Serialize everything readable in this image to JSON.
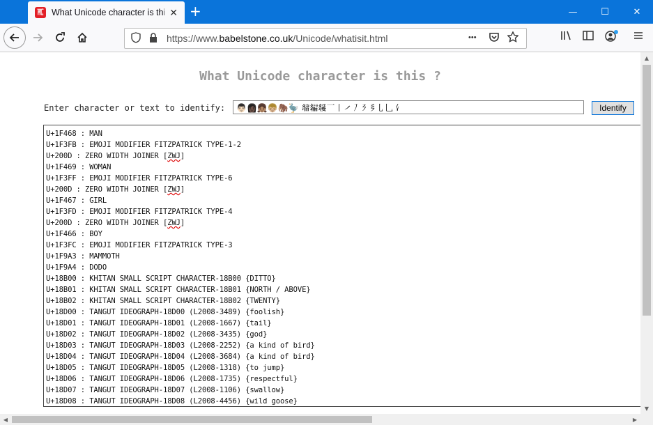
{
  "browser": {
    "tab_title": "What Unicode character is this",
    "tab_favicon_glyph": "𗀀",
    "new_tab_glyph": "+",
    "close_glyph": "✕",
    "min_glyph": "—",
    "max_glyph": "☐",
    "win_close_glyph": "✕",
    "url_scheme": "https://www.",
    "url_domain": "babelstone.co.uk",
    "url_path": "/Unicode/whatisit.html",
    "page_actions_glyph": "•••"
  },
  "page": {
    "title": "What Unicode character is this ?",
    "prompt": "Enter character or text to identify:",
    "input_value": "👨🏻‍👩🏿‍👧🏽‍👦🏼🦣🦤 𘀀𘀁𘀂𘠀𘠁𘠂𘠃𘠄𘠅𘠆𘠇𘠈",
    "identify_label": "Identify"
  },
  "output_lines": [
    "U+1F468 : MAN",
    "U+1F3FB : EMOJI MODIFIER FITZPATRICK TYPE-1-2",
    "U+200D : ZERO WIDTH JOINER [ZWJ]",
    "U+1F469 : WOMAN",
    "U+1F3FF : EMOJI MODIFIER FITZPATRICK TYPE-6",
    "U+200D : ZERO WIDTH JOINER [ZWJ]",
    "U+1F467 : GIRL",
    "U+1F3FD : EMOJI MODIFIER FITZPATRICK TYPE-4",
    "U+200D : ZERO WIDTH JOINER [ZWJ]",
    "U+1F466 : BOY",
    "U+1F3FC : EMOJI MODIFIER FITZPATRICK TYPE-3",
    "U+1F9A3 : MAMMOTH",
    "U+1F9A4 : DODO",
    "U+18B00 : KHITAN SMALL SCRIPT CHARACTER-18B00 {DITTO}",
    "U+18B01 : KHITAN SMALL SCRIPT CHARACTER-18B01 {NORTH / ABOVE}",
    "U+18B02 : KHITAN SMALL SCRIPT CHARACTER-18B02 {TWENTY}",
    "U+18D00 : TANGUT IDEOGRAPH-18D00 (L2008-3489) {foolish}",
    "U+18D01 : TANGUT IDEOGRAPH-18D01 (L2008-1667) {tail}",
    "U+18D02 : TANGUT IDEOGRAPH-18D02 (L2008-3435) {god}",
    "U+18D03 : TANGUT IDEOGRAPH-18D03 (L2008-2252) {a kind of bird}",
    "U+18D04 : TANGUT IDEOGRAPH-18D04 (L2008-3684) {a kind of bird}",
    "U+18D05 : TANGUT IDEOGRAPH-18D05 (L2008-1318) {to jump}",
    "U+18D06 : TANGUT IDEOGRAPH-18D06 (L2008-1735) {respectful}",
    "U+18D07 : TANGUT IDEOGRAPH-18D07 (L2008-1106) {swallow}",
    "U+18D08 : TANGUT IDEOGRAPH-18D08 (L2008-4456) {wild goose}"
  ],
  "colors": {
    "titlebar": "#0a74da",
    "page_title": "#999999"
  }
}
